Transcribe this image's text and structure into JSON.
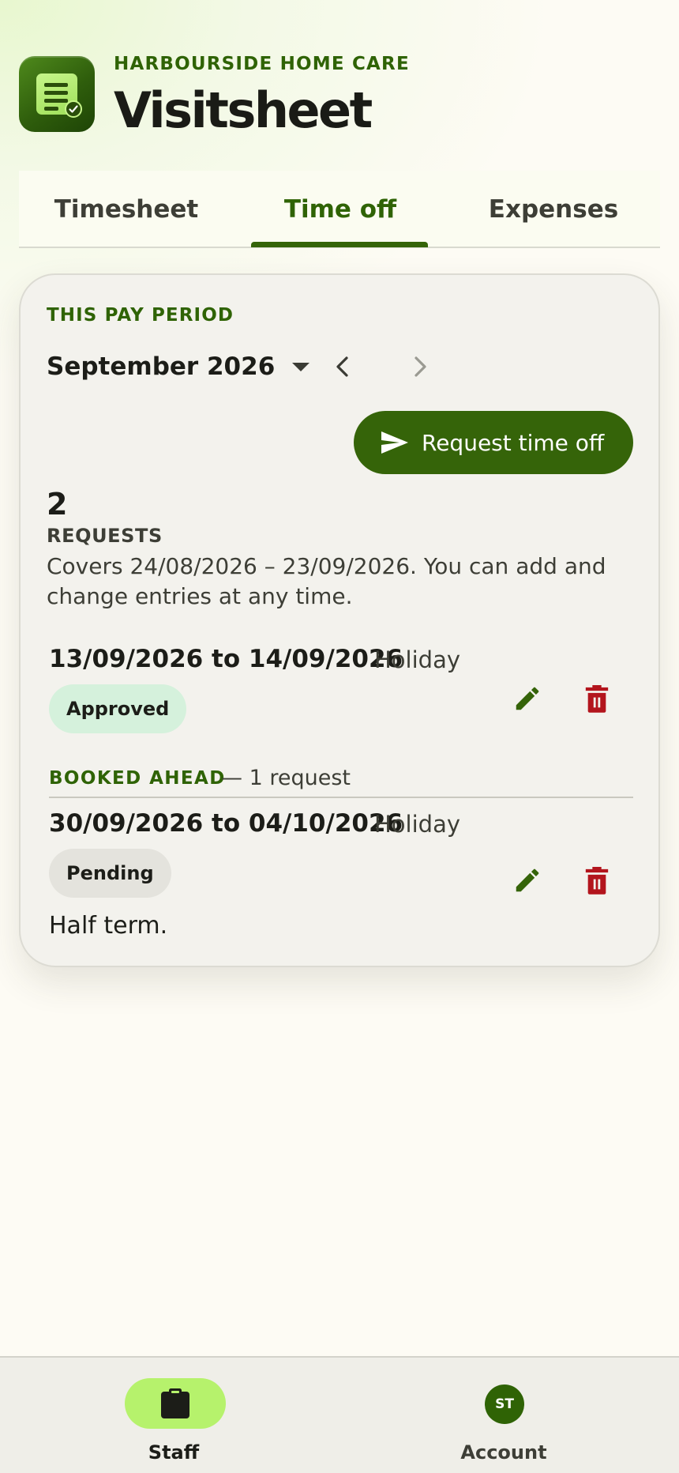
{
  "header": {
    "brand": "HARBOURSIDE HOME CARE",
    "title": "Visitsheet",
    "icon": "visitsheet-app-icon"
  },
  "tabs": [
    {
      "label": "Timesheet",
      "active": false
    },
    {
      "label": "Time off",
      "active": true
    },
    {
      "label": "Expenses",
      "active": false
    }
  ],
  "period": {
    "label": "THIS PAY PERIOD",
    "month": "September 2026",
    "prev_icon": "chevron-left-icon",
    "next_icon": "chevron-right-icon",
    "next_disabled": true
  },
  "request_button": {
    "label": "Request time off",
    "icon": "send-icon"
  },
  "summary": {
    "count": "2",
    "count_label": "REQUESTS",
    "covers": "Covers 24/08/2026 – 23/09/2026. You can add and change entries at any time."
  },
  "entries": [
    {
      "dates": "13/09/2026 to 14/09/2026",
      "type": "Holiday",
      "status": "Approved",
      "note": ""
    }
  ],
  "booked_ahead": {
    "title": "BOOKED AHEAD",
    "count_text": "— 1 request",
    "entries": [
      {
        "dates": "30/09/2026 to 04/10/2026",
        "type": "Holiday",
        "status": "Pending",
        "note": "Half term."
      }
    ]
  },
  "bottom_nav": [
    {
      "label": "Staff",
      "icon": "clipboard-icon",
      "active": true
    },
    {
      "label": "Account",
      "avatar": "ST",
      "active": false
    }
  ],
  "colors": {
    "primary": "#356409",
    "primary_text": "#2f6305",
    "danger": "#b3151d",
    "approved_bg": "#d5f1dc",
    "pending_bg": "#e4e3dd",
    "nav_active_bg": "#b6f26c"
  }
}
